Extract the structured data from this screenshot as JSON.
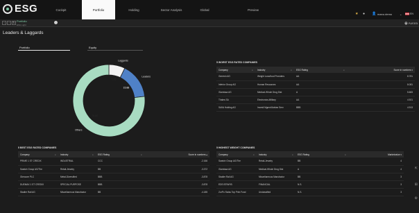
{
  "app": {
    "logo": "ESG"
  },
  "nav": {
    "tabs": [
      "Cockpit",
      "Portfolio",
      "Holding",
      "Sector Analysis",
      "Global",
      "Preview"
    ],
    "active": "Portfolio"
  },
  "header": {
    "user": "manu.demo",
    "language": "EN"
  },
  "toolbar": {
    "tab_title": "Portfolio",
    "tab_sub": "ESG Light",
    "right_label": "Aurora"
  },
  "page": {
    "title": "Leaders & Laggards"
  },
  "subtabs": {
    "items": [
      "Portfolio",
      "Equity"
    ]
  },
  "colors": {
    "accent": "#7cc9a3",
    "leaders": "#4f81c7",
    "laggards": "#f2f2f2",
    "others": "#a8dcc2"
  },
  "chart_data": {
    "type": "pie",
    "variant": "donut",
    "categories": [
      "Laggards",
      "Leaders",
      "Others"
    ],
    "values": [
      7.25,
      15.88,
      76.88
    ],
    "data_labels": [
      "7.25",
      "15.88",
      "76.88"
    ]
  },
  "worst_table": {
    "title": "5 WORST ESG RATED COMPANIES",
    "headers": [
      "Company",
      "Industry",
      "ESG Rating",
      "Score in numbers"
    ],
    "rows": [
      [
        "Gerresh AG",
        "Weight Loss/food Providers",
        "AA",
        "8.781"
      ],
      [
        "Inferior Group AG",
        "Human Resources",
        "AA",
        "8.081"
      ],
      [
        "Glamissa AG",
        "Medical-Whole Drug Dist",
        "A",
        "5.683"
      ],
      [
        "Thales SA",
        "Electronics-Military",
        "AA",
        "4.921"
      ],
      [
        "SAVA Holding AG",
        "Investl Mgmnt/Advise Serv",
        "BBB",
        "4.913"
      ]
    ]
  },
  "best_table": {
    "title": "5 BEST ESG RATED COMPANIES",
    "headers": [
      "Company",
      "Industry",
      "ESG Rating",
      "Score in numbers"
    ],
    "rows": [
      [
        "PRIME 1 ST CREDIX",
        "INDUSTRIAL",
        "CCC",
        "-2.166"
      ],
      [
        "Swatch Group AG/The",
        "Retail-Jewelry",
        "BB",
        "-3.372"
      ],
      [
        "Glencore PLC",
        "Metal-Diversified",
        "BBB",
        "-3.878"
      ],
      [
        "DUEMAX 1 ST CREDIX",
        "SPECIAL PURPOSE",
        "BBB",
        "-3.878"
      ],
      [
        "Stadler Rail AG",
        "Miscellaneous Manufactur",
        "BB",
        "-4.185"
      ]
    ]
  },
  "weight_table": {
    "title": "5 HIGHEST WEIGHT COMPANIES",
    "headers": [
      "Company",
      "Industry",
      "ESG Rating",
      "Marketvalue"
    ],
    "rows": [
      [
        "Swatch Group AG/The",
        "Retail-Jewelry",
        "BB",
        "4"
      ],
      [
        "Glamissa AG",
        "Medical-Whole Drug Dist",
        "A",
        "4"
      ],
      [
        "Stadler Rail AG",
        "Miscellaneous Manufactur",
        "BB",
        "3"
      ],
      [
        "EDS BTIWYB",
        "FINANCIAL",
        "N.S.",
        "3"
      ],
      [
        "ZurPo Swiss Top Prim Fund",
        "Unclassified",
        "N.S.",
        "3"
      ]
    ]
  }
}
